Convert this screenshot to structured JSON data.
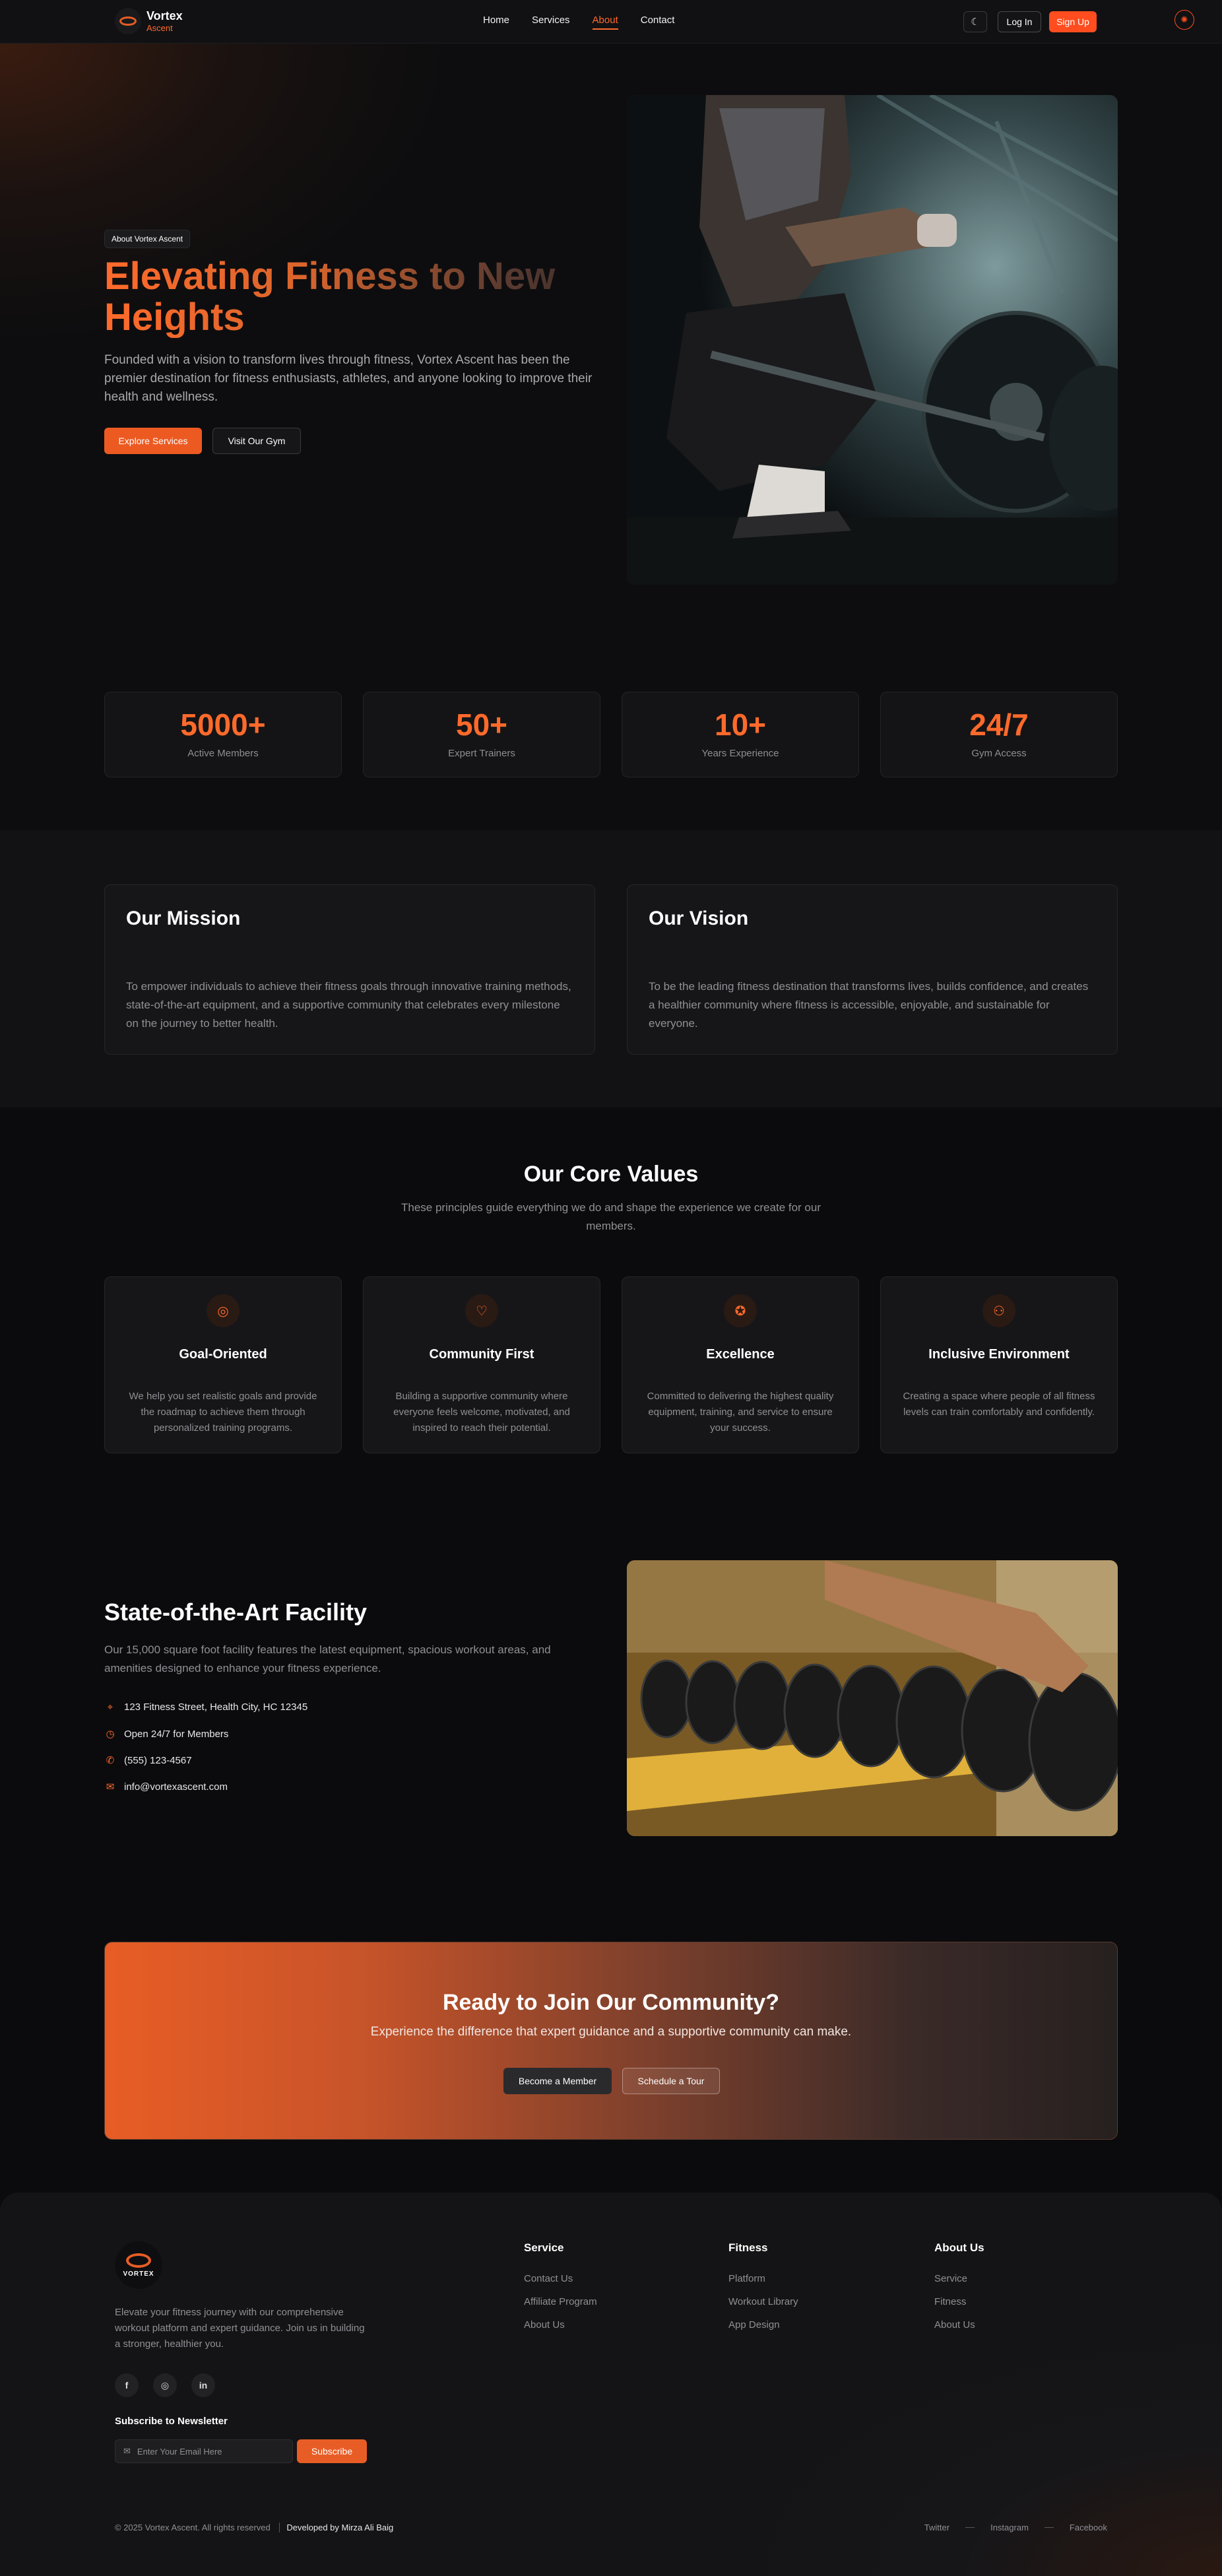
{
  "nav": {
    "brand_name": "Vortex",
    "brand_sub": "Ascent",
    "links": [
      "Home",
      "Services",
      "About",
      "Contact"
    ],
    "active_link": "About",
    "login_label": "Log In",
    "signup_label": "Sign Up"
  },
  "hero": {
    "badge": "About Vortex Ascent",
    "title": "Elevating Fitness to New Heights",
    "description": "Founded with a vision to transform lives through fitness, Vortex Ascent has been the premier destination for fitness enthusiasts, athletes, and anyone looking to improve their health and wellness.",
    "primary_button": "Explore Services",
    "secondary_button": "Visit Our Gym"
  },
  "stats": [
    {
      "value": "5000+",
      "label": "Active Members"
    },
    {
      "value": "50+",
      "label": "Expert Trainers"
    },
    {
      "value": "10+",
      "label": "Years Experience"
    },
    {
      "value": "24/7",
      "label": "Gym Access"
    }
  ],
  "mission": {
    "title": "Our Mission",
    "text": "To empower individuals to achieve their fitness goals through innovative training methods, state-of-the-art equipment, and a supportive community that celebrates every milestone on the journey to better health."
  },
  "vision": {
    "title": "Our Vision",
    "text": "To be the leading fitness destination that transforms lives, builds confidence, and creates a healthier community where fitness is accessible, enjoyable, and sustainable for everyone."
  },
  "values": {
    "title": "Our Core Values",
    "subtitle": "These principles guide everything we do and shape the experience we create for our members.",
    "items": [
      {
        "icon": "target-icon",
        "title": "Goal-Oriented",
        "text": "We help you set realistic goals and provide the roadmap to achieve them through personalized training programs."
      },
      {
        "icon": "heart-icon",
        "title": "Community First",
        "text": "Building a supportive community where everyone feels welcome, motivated, and inspired to reach their potential."
      },
      {
        "icon": "award-icon",
        "title": "Excellence",
        "text": "Committed to delivering the highest quality equipment, training, and service to ensure your success."
      },
      {
        "icon": "users-icon",
        "title": "Inclusive Environment",
        "text": "Creating a space where people of all fitness levels can train comfortably and confidently."
      }
    ]
  },
  "facility": {
    "title": "State-of-the-Art Facility",
    "description": "Our 15,000 square foot facility features the latest equipment, spacious workout areas, and amenities designed to enhance your fitness experience.",
    "address": "123 Fitness Street, Health City, HC 12345",
    "hours": "Open 24/7 for Members",
    "phone": "(555) 123-4567",
    "email": "info@vortexascent.com"
  },
  "cta": {
    "title": "Ready to Join Our Community?",
    "text": "Experience the difference that expert guidance and a supportive community can make.",
    "primary_button": "Become a Member",
    "secondary_button": "Schedule a Tour"
  },
  "footer": {
    "logo_text": "VORTEX",
    "description": "Elevate your fitness journey with our comprehensive workout platform and expert guidance. Join us in building a stronger, healthier you.",
    "newsletter_title": "Subscribe to Newsletter",
    "newsletter_placeholder": "Enter Your Email Here",
    "subscribe_label": "Subscribe",
    "columns": [
      {
        "title": "Service",
        "links": [
          "Contact Us",
          "Affiliate Program",
          "About Us"
        ]
      },
      {
        "title": "Fitness",
        "links": [
          "Platform",
          "Workout Library",
          "App Design"
        ]
      },
      {
        "title": "About Us",
        "links": [
          "Service",
          "Fitness",
          "About Us"
        ]
      }
    ],
    "copyright": "© 2025 Vortex Ascent. All rights reserved",
    "developer": "Developed by Mirza Ali Baig",
    "social_links": [
      "Twitter",
      "Instagram",
      "Facebook"
    ]
  },
  "colors": {
    "accent": "#ff6a2b",
    "background": "#0b0b0d",
    "card": "#161618"
  }
}
